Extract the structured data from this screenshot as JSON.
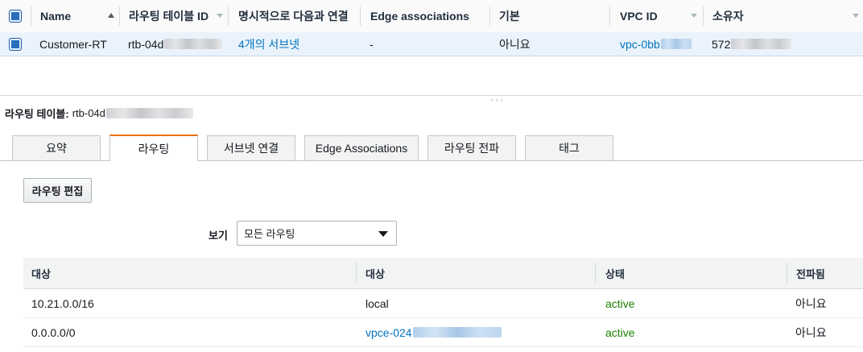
{
  "list": {
    "columns": [
      "Name",
      "라우팅 테이블 ID",
      "명시적으로 다음과 연결",
      "Edge associations",
      "기본",
      "VPC ID",
      "소유자"
    ],
    "row": {
      "name": "Customer-RT",
      "route_table_id": "rtb-04d",
      "explicit_association": "4개의 서브넷",
      "edge_associations": "-",
      "main": "아니요",
      "vpc_id": "vpc-0bb",
      "owner": "572"
    }
  },
  "detail": {
    "title_label": "라우팅 테이블:",
    "title_value": "rtb-04d"
  },
  "tabs": [
    "요약",
    "라우팅",
    "서브넷 연결",
    "Edge Associations",
    "라우팅 전파",
    "태그"
  ],
  "active_tab": "라우팅",
  "edit_routes_button": "라우팅 편집",
  "filter": {
    "label": "보기",
    "selected": "모든 라우팅"
  },
  "routes": {
    "columns": [
      "대상",
      "대상",
      "상태",
      "전파됨"
    ],
    "rows": [
      {
        "destination": "10.21.0.0/16",
        "target": "local",
        "status": "active",
        "propagated": "아니요"
      },
      {
        "destination": "0.0.0.0/0",
        "target": "vpce-024",
        "status": "active",
        "propagated": "아니요"
      }
    ]
  },
  "colors": {
    "link": "#0073bb",
    "active_status": "#1d8102",
    "tab_accent": "#ec7211",
    "selected_row": "#eaf3fb"
  }
}
